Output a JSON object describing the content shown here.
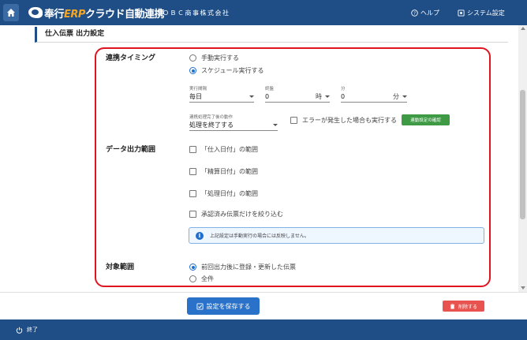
{
  "header": {
    "logo_main": "奉行",
    "logo_em": "ERP",
    "logo_rest": "クラウド自動連携",
    "company": "ＯＢＣ商事株式会社",
    "help": "ヘルプ",
    "settings": "システム設定"
  },
  "section": {
    "title": "仕入伝票 出力設定"
  },
  "timing": {
    "label": "連携タイミング",
    "options": [
      "手動実行する",
      "スケジュール実行する"
    ],
    "selected": 1,
    "interval_label": "実行間隔",
    "interval_value": "毎日",
    "end_label": "終盤",
    "hour_value": "0",
    "hour_unit": "時",
    "minute_label": "分",
    "minute_value": "0",
    "minute_unit": "分",
    "after_label": "連携処理完了後の動作",
    "after_value": "処理を終了する",
    "error_check": "エラーが発生した場合も実行する",
    "confirm_button": "連動設定の確認"
  },
  "data_range": {
    "label": "データ出力範囲",
    "checks": [
      "「仕入日付」の範囲",
      "「精算日付」の範囲",
      "「処理日付」の範囲",
      "承認済み伝票だけを絞り込む"
    ],
    "info": "上記設定は手動実行の場合には反映しません。"
  },
  "target": {
    "label": "対象範囲",
    "options": [
      "前回出力後に登録・更新した伝票",
      "全件"
    ],
    "selected": 0
  },
  "footer": {
    "save": "設定を保存する",
    "delete": "削除する",
    "exit": "終了"
  },
  "colors": {
    "header": "#1f4e86",
    "accent": "#2a72c9",
    "highlight": "#e0141e",
    "confirm": "#3e9a45",
    "delete": "#e8534f"
  },
  "icons": [
    "home-icon",
    "help-icon",
    "gear-icon",
    "info-icon",
    "save-icon",
    "trash-icon",
    "power-icon"
  ]
}
